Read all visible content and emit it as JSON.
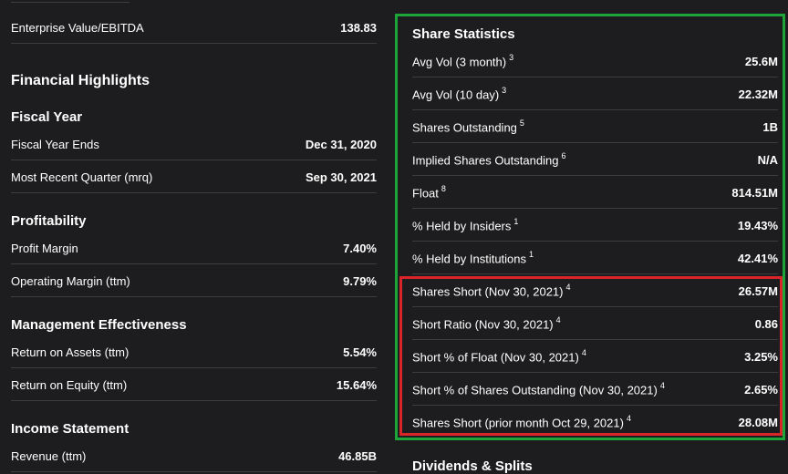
{
  "left": {
    "top_row": {
      "label": "Enterprise Value/EBITDA",
      "value": "138.83"
    },
    "financial_highlights": "Financial Highlights",
    "fiscal_year": {
      "title": "Fiscal Year",
      "rows": [
        {
          "label": "Fiscal Year Ends",
          "value": "Dec 31, 2020"
        },
        {
          "label": "Most Recent Quarter (mrq)",
          "value": "Sep 30, 2021"
        }
      ]
    },
    "profitability": {
      "title": "Profitability",
      "rows": [
        {
          "label": "Profit Margin",
          "value": "7.40%"
        },
        {
          "label": "Operating Margin (ttm)",
          "value": "9.79%"
        }
      ]
    },
    "management": {
      "title": "Management Effectiveness",
      "rows": [
        {
          "label": "Return on Assets (ttm)",
          "value": "5.54%"
        },
        {
          "label": "Return on Equity (ttm)",
          "value": "15.64%"
        }
      ]
    },
    "income": {
      "title": "Income Statement",
      "rows": [
        {
          "label": "Revenue (ttm)",
          "value": "46.85B"
        }
      ]
    }
  },
  "right": {
    "share_statistics": {
      "title": "Share Statistics",
      "rows": [
        {
          "label": "Avg Vol (3 month)",
          "sup": "3",
          "value": "25.6M"
        },
        {
          "label": "Avg Vol (10 day)",
          "sup": "3",
          "value": "22.32M"
        },
        {
          "label": "Shares Outstanding",
          "sup": "5",
          "value": "1B"
        },
        {
          "label": "Implied Shares Outstanding",
          "sup": "6",
          "value": "N/A"
        },
        {
          "label": "Float",
          "sup": "8",
          "value": "814.51M"
        },
        {
          "label": "% Held by Insiders",
          "sup": "1",
          "value": "19.43%"
        },
        {
          "label": "% Held by Institutions",
          "sup": "1",
          "value": "42.41%"
        },
        {
          "label": "Shares Short (Nov 30, 2021)",
          "sup": "4",
          "value": "26.57M"
        },
        {
          "label": "Short Ratio (Nov 30, 2021)",
          "sup": "4",
          "value": "0.86"
        },
        {
          "label": "Short % of Float (Nov 30, 2021)",
          "sup": "4",
          "value": "3.25%"
        },
        {
          "label": "Short % of Shares Outstanding (Nov 30, 2021)",
          "sup": "4",
          "value": "2.65%"
        },
        {
          "label": "Shares Short (prior month Oct 29, 2021)",
          "sup": "4",
          "value": "28.08M"
        }
      ]
    },
    "dividends": {
      "title": "Dividends & Splits"
    }
  },
  "highlight_colors": {
    "green": "#1ea53a",
    "red": "#d9252a"
  }
}
